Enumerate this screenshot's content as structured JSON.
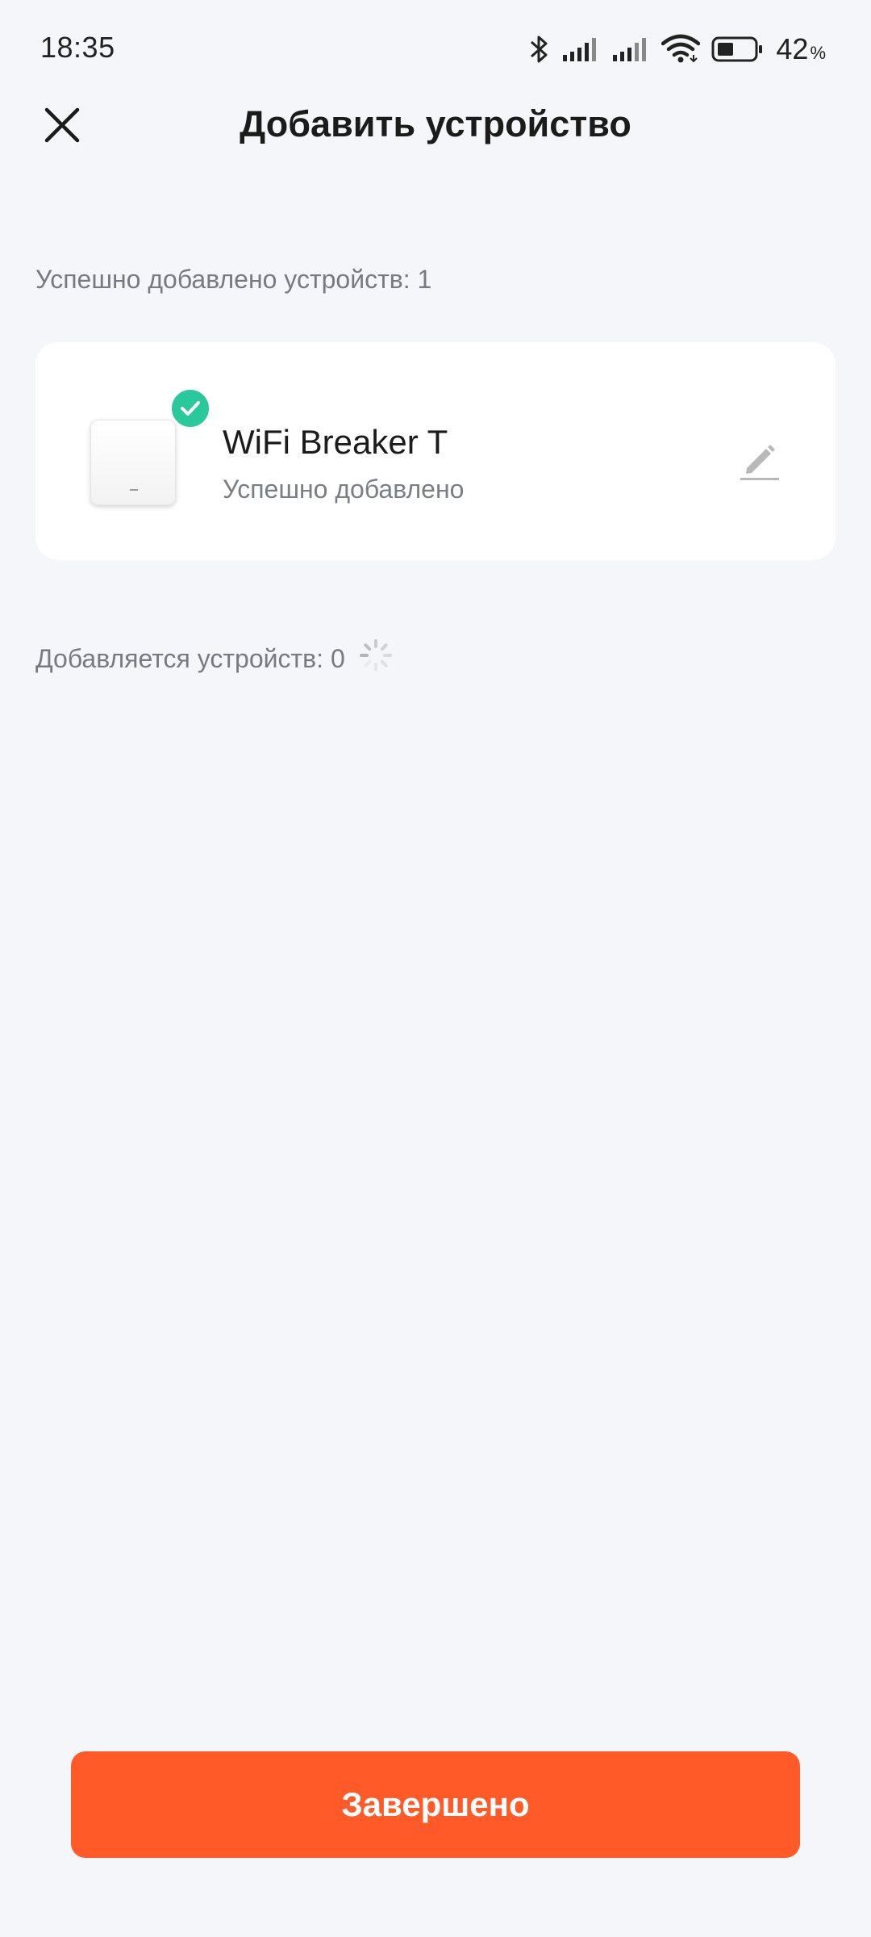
{
  "status_bar": {
    "time": "18:35",
    "battery_value": "42",
    "battery_unit": "%",
    "icons": [
      "bluetooth-icon",
      "signal-icon",
      "signal-icon",
      "wifi-icon",
      "battery-icon"
    ]
  },
  "header": {
    "title": "Добавить устройство",
    "close_icon": "close-icon"
  },
  "added_section": {
    "label": "Успешно добавлено устройств: 1"
  },
  "devices": [
    {
      "name": "WiFi Breaker T",
      "status": "Успешно добавлено",
      "badge_icon": "check-icon",
      "action_icon": "edit-icon"
    }
  ],
  "adding_section": {
    "label": "Добавляется устройств: 0",
    "spinner_icon": "spinner-icon"
  },
  "footer": {
    "done_label": "Завершено"
  },
  "colors": {
    "background": "#f5f6fa",
    "accent": "#ff5a28",
    "success": "#2ac99b",
    "card": "#ffffff"
  }
}
